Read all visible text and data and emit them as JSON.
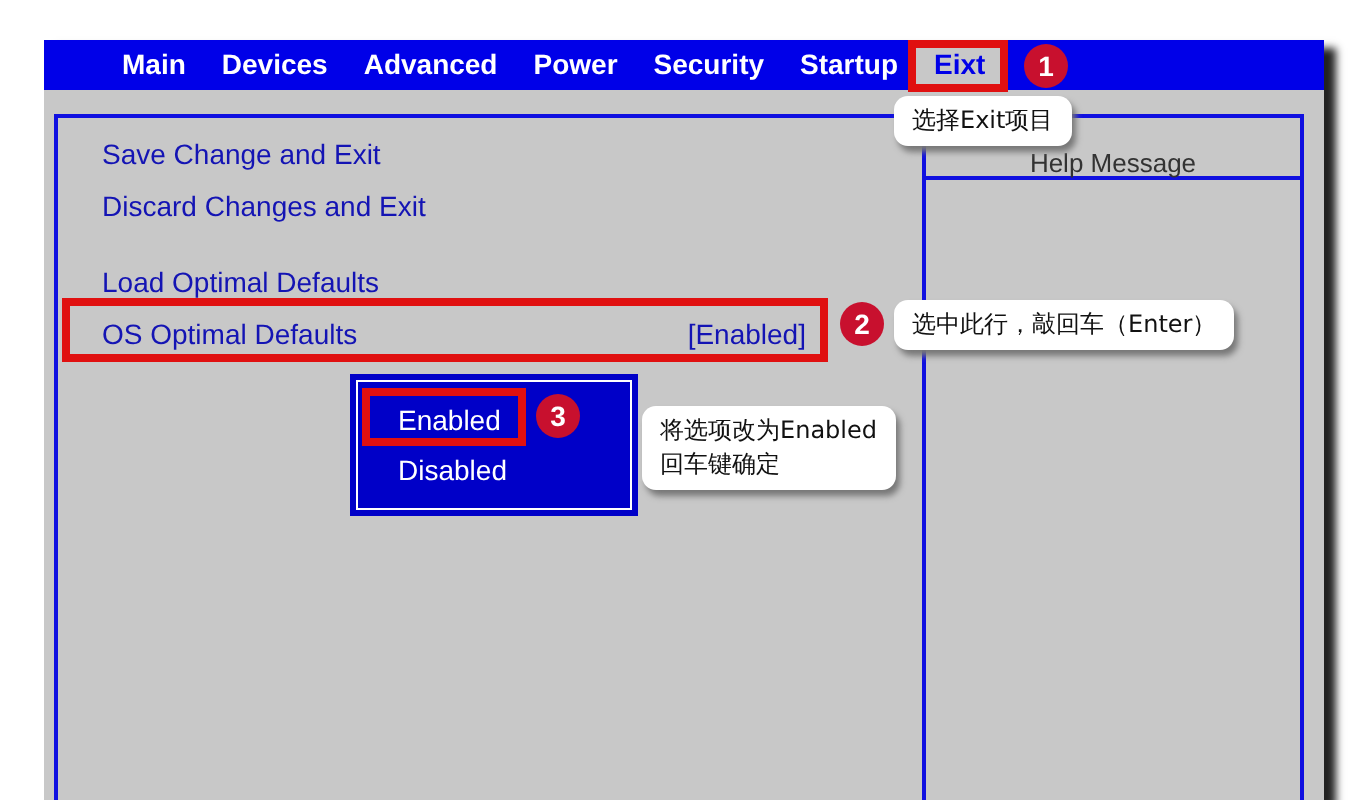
{
  "menu": [
    {
      "label": "Main",
      "selected": false
    },
    {
      "label": "Devices",
      "selected": false
    },
    {
      "label": "Advanced",
      "selected": false
    },
    {
      "label": "Power",
      "selected": false
    },
    {
      "label": "Security",
      "selected": false
    },
    {
      "label": "Startup",
      "selected": false
    },
    {
      "label": "Eixt",
      "selected": true
    }
  ],
  "groups": [
    [
      {
        "label": "Save Change and Exit"
      },
      {
        "label": "Discard Changes and Exit"
      }
    ],
    [
      {
        "label": "Load Optimal Defaults"
      },
      {
        "label": "OS Optimal Defaults",
        "value": "[Enabled]"
      }
    ]
  ],
  "help_panel": {
    "title": "Help Message"
  },
  "popup": {
    "options": [
      {
        "label": "Enabled"
      },
      {
        "label": "Disabled"
      }
    ]
  },
  "annotations": [
    {
      "number": "1",
      "lines": [
        "选择Exit项目"
      ]
    },
    {
      "number": "2",
      "lines": [
        "选中此行，敲回车（Enter）"
      ]
    },
    {
      "number": "3",
      "lines": [
        "将选项改为Enabled",
        "回车键确定"
      ]
    }
  ]
}
